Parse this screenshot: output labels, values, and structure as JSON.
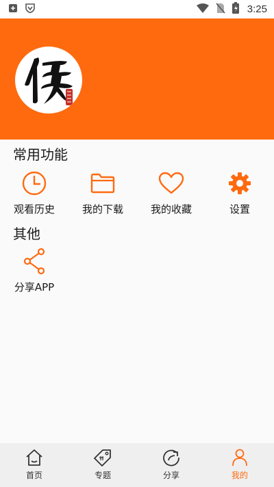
{
  "status_bar": {
    "time": "3:25",
    "icons": [
      "notification-icon",
      "shield-app-icon",
      "wifi-icon",
      "no-sim-icon",
      "battery-charging-icon"
    ]
  },
  "header": {
    "background_color": "#ff6a0f",
    "avatar": "calligraphy-logo"
  },
  "common_functions": {
    "title": "常用功能",
    "items": [
      {
        "label": "观看历史",
        "icon": "clock-icon"
      },
      {
        "label": "我的下载",
        "icon": "folder-icon"
      },
      {
        "label": "我的收藏",
        "icon": "heart-icon"
      },
      {
        "label": "设置",
        "icon": "gear-icon"
      }
    ]
  },
  "other": {
    "title": "其他",
    "items": [
      {
        "label": "分享APP",
        "icon": "share-icon"
      }
    ]
  },
  "tab_bar": {
    "active_color": "#ff6a0f",
    "tabs": [
      {
        "label": "首页",
        "icon": "home-icon",
        "active": false
      },
      {
        "label": "专题",
        "icon": "tag-icon",
        "active": false
      },
      {
        "label": "分享",
        "icon": "refresh-share-icon",
        "active": false
      },
      {
        "label": "我的",
        "icon": "person-icon",
        "active": true
      }
    ]
  }
}
